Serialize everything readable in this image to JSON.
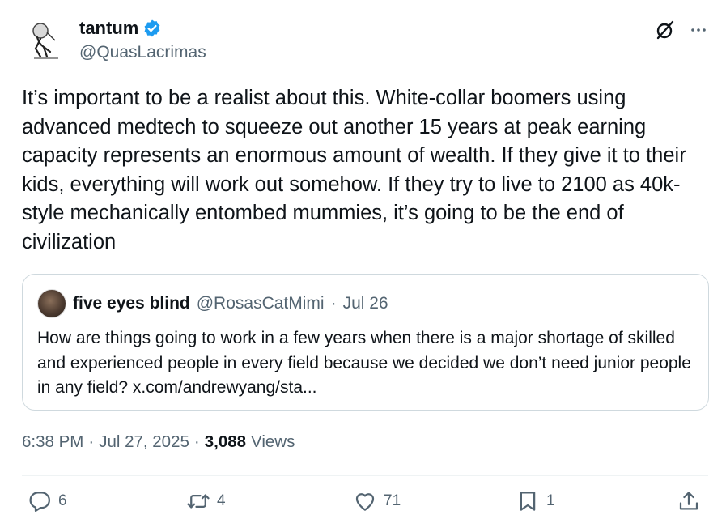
{
  "author": {
    "name": "tantum",
    "handle": "@QuasLacrimas",
    "verified_color": "#1d9bf0"
  },
  "tweet": {
    "text": "It’s important to be a realist about this. White-collar boomers using advanced medtech to squeeze out another 15 years at peak earning capacity represents an enormous amount of wealth. If they give it to their kids, everything will work out somehow. If they try to live to 2100 as 40k-style mechanically entombed mummies, it’s going to be the end of civilization"
  },
  "quote": {
    "name": "five eyes blind",
    "handle": "@RosasCatMimi",
    "separator": "·",
    "date": "Jul 26",
    "text": "How are things going to work in a few years when there is a major shortage of skilled and experienced people in every field because we decided we don’t need junior people in any field? x.com/andrewyang/sta..."
  },
  "meta": {
    "time": "6:38 PM",
    "sep1": "·",
    "date": "Jul 27, 2025",
    "sep2": "·",
    "views_count": "3,088",
    "views_label": "Views"
  },
  "actions": {
    "replies": "6",
    "reposts": "4",
    "likes": "71",
    "bookmarks": "1"
  },
  "icons": [
    "grok-icon",
    "more-icon",
    "reply-icon",
    "repost-icon",
    "like-icon",
    "bookmark-icon",
    "share-icon",
    "verified-icon"
  ]
}
